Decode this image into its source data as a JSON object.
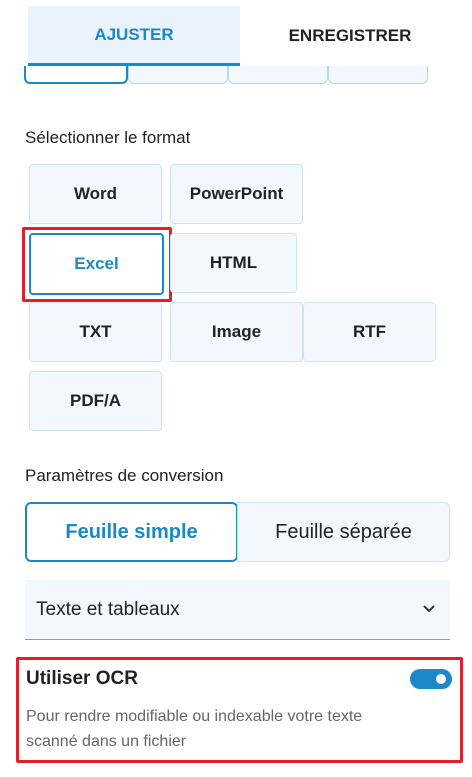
{
  "tabs": [
    {
      "label": "AJUSTER",
      "active": true
    },
    {
      "label": "ENREGISTRER",
      "active": false
    }
  ],
  "format_section": {
    "title": "Sélectionner le format",
    "options": [
      "Word",
      "PowerPoint",
      "Excel",
      "HTML",
      "TXT",
      "Image",
      "RTF",
      "PDF/A"
    ],
    "selected": "Excel"
  },
  "conversion_section": {
    "title": "Paramètres de conversion",
    "sheet_options": [
      "Feuille simple",
      "Feuille séparée"
    ],
    "selected_sheet": "Feuille simple",
    "content_select": {
      "value": "Texte et tableaux",
      "icon": "chevron-down-icon"
    }
  },
  "ocr": {
    "label": "Utiliser OCR",
    "description": "Pour rendre modifiable ou indexable votre texte scanné dans un fichier",
    "enabled": true
  },
  "colors": {
    "accent": "#1a88c9",
    "highlight_frame": "#e0202a",
    "tile_bg": "#f2f8fd"
  }
}
